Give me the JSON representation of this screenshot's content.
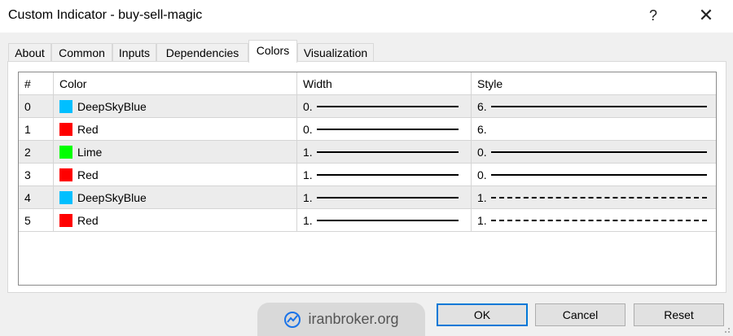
{
  "window": {
    "title": "Custom Indicator - buy-sell-magic",
    "help_label": "?",
    "close_label": "✕"
  },
  "tabs": [
    "About",
    "Common",
    "Inputs",
    "Dependencies",
    "Colors",
    "Visualization"
  ],
  "active_tab": "Colors",
  "table": {
    "headers": [
      "#",
      "Color",
      "Width",
      "Style"
    ],
    "rows": [
      {
        "index": "0",
        "color": "DeepSkyBlue",
        "swatch": "#00bfff",
        "width": "0.",
        "style": "6.",
        "style_line": "solid"
      },
      {
        "index": "1",
        "color": "Red",
        "swatch": "#ff0000",
        "width": "0.",
        "style": "6.",
        "style_line": "none"
      },
      {
        "index": "2",
        "color": "Lime",
        "swatch": "#00ff00",
        "width": "1.",
        "style": "0.",
        "style_line": "solid"
      },
      {
        "index": "3",
        "color": "Red",
        "swatch": "#ff0000",
        "width": "1.",
        "style": "0.",
        "style_line": "solid"
      },
      {
        "index": "4",
        "color": "DeepSkyBlue",
        "swatch": "#00bfff",
        "width": "1.",
        "style": "1.",
        "style_line": "dash"
      },
      {
        "index": "5",
        "color": "Red",
        "swatch": "#ff0000",
        "width": "1.",
        "style": "1.",
        "style_line": "dash"
      }
    ]
  },
  "buttons": {
    "ok": "OK",
    "cancel": "Cancel",
    "reset": "Reset"
  },
  "watermark": {
    "text": "iranbroker.org",
    "icon": "chart-logo-icon"
  },
  "colors": {
    "accent": "#0078d7",
    "alt_row": "#ececec"
  }
}
